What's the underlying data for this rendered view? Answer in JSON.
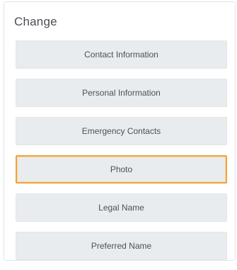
{
  "panel": {
    "title": "Change"
  },
  "buttons": [
    {
      "label": "Contact Information",
      "selected": false
    },
    {
      "label": "Personal Information",
      "selected": false
    },
    {
      "label": "Emergency Contacts",
      "selected": false
    },
    {
      "label": "Photo",
      "selected": true
    },
    {
      "label": "Legal Name",
      "selected": false
    },
    {
      "label": "Preferred Name",
      "selected": false
    }
  ],
  "colors": {
    "button_background": "#e9ecee",
    "selected_border": "#f0a43a",
    "title_text": "#4a4f55"
  }
}
